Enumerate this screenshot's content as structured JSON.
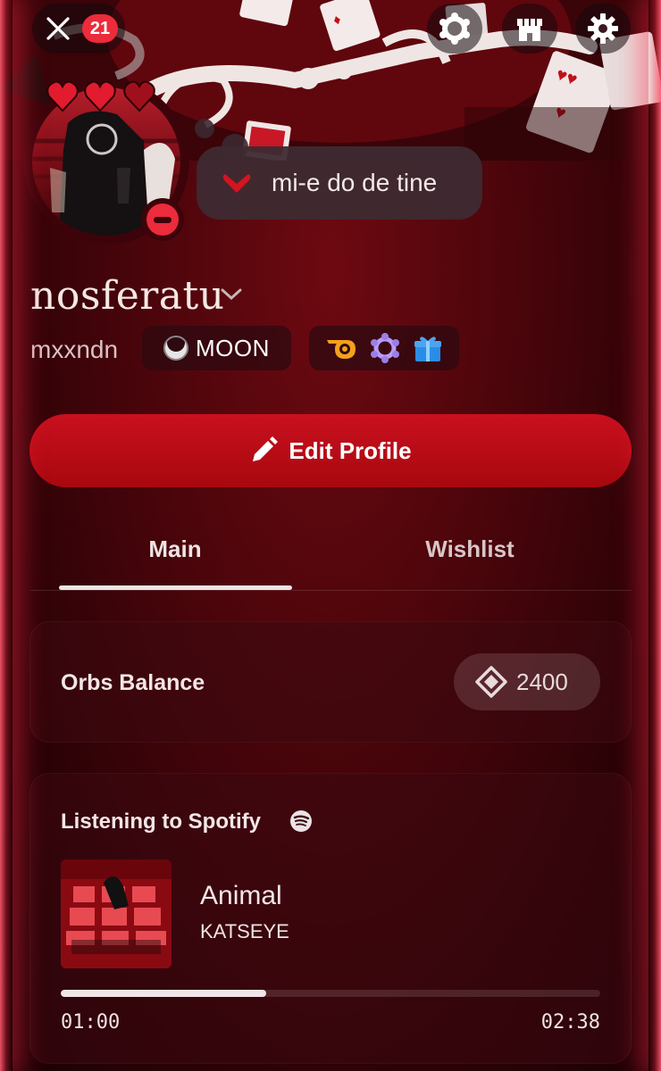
{
  "notifications": {
    "count": "21"
  },
  "status": {
    "text": "mi-e do de tine"
  },
  "profile": {
    "display_name": "nosferatu",
    "username": "mxxndn",
    "tag": "MOON"
  },
  "actions": {
    "edit_profile": "Edit Profile"
  },
  "tabs": [
    {
      "label": "Main"
    },
    {
      "label": "Wishlist"
    }
  ],
  "orbs": {
    "label": "Orbs Balance",
    "value": "2400"
  },
  "spotify": {
    "title": "Listening to Spotify",
    "song": "Animal",
    "artist": "KATSEYE",
    "elapsed": "01:00",
    "duration": "02:38",
    "progress_fraction": 0.38
  },
  "colors": {
    "accent": "#c9101f",
    "dnd_status": "#ec2b3b",
    "badge": "#ec2b3b"
  },
  "icons": [
    "close-icon",
    "nitro-icon",
    "shop-icon",
    "gear-icon",
    "heart-icon",
    "dnd-icon",
    "pencil-icon",
    "orb-icon",
    "spotify-icon"
  ]
}
